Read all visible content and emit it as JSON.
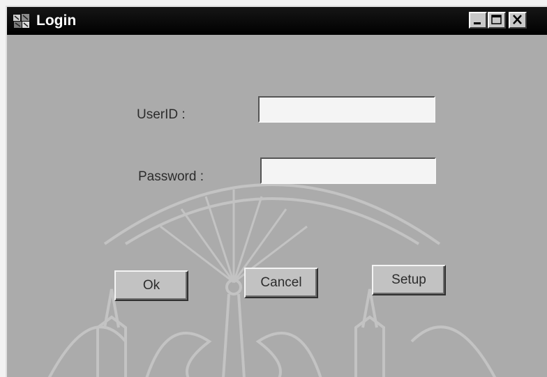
{
  "window": {
    "title": "Login",
    "controls": [
      "minimize-icon",
      "maximize-icon",
      "close-icon"
    ]
  },
  "form": {
    "userid_label": "UserID :",
    "userid_value": "",
    "password_label": "Password :",
    "password_value": ""
  },
  "buttons": {
    "ok_label": "Ok",
    "cancel_label": "Cancel",
    "setup_label": "Setup"
  },
  "colors": {
    "titlebar": "#000000",
    "window_background": "#ababab",
    "textbox_background": "#f4f4f4",
    "button_face": "#c2c2c2"
  }
}
